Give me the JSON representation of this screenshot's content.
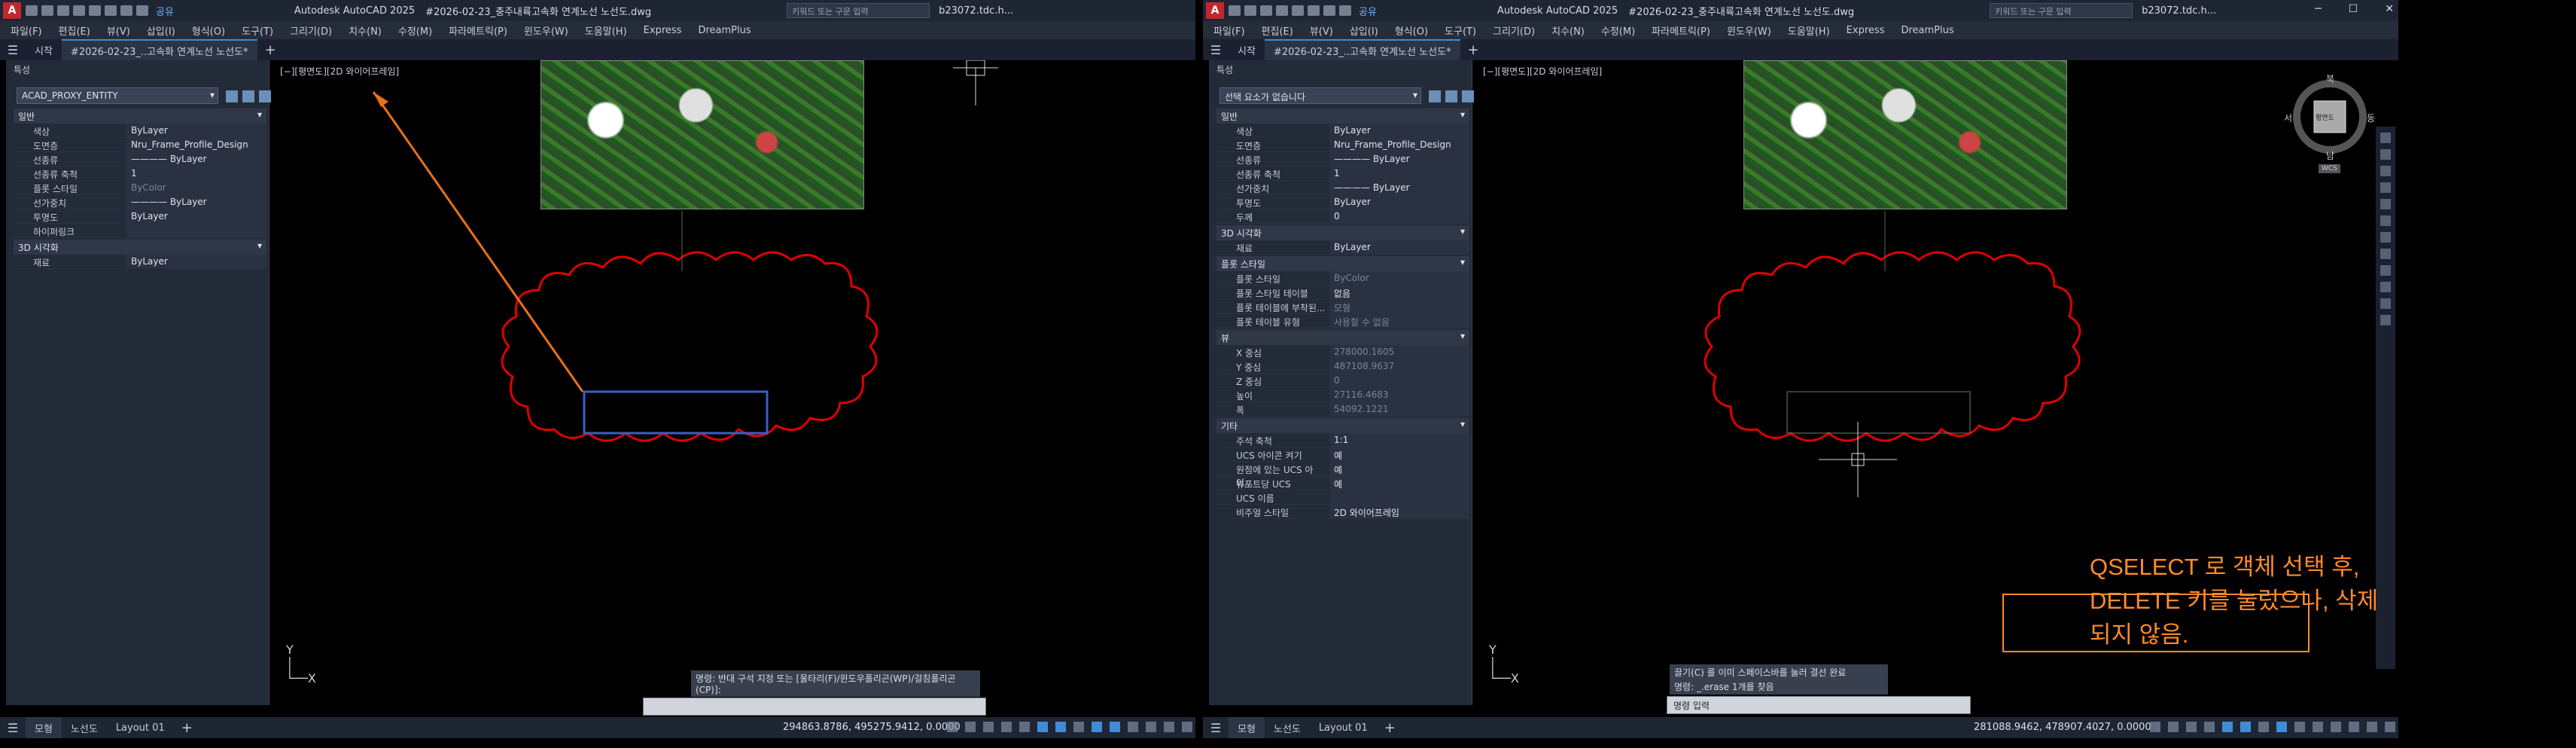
{
  "left": {
    "app_title": "Autodesk AutoCAD 2025",
    "doc_title": "#2026-02-23_충주내륙고속화 연계노선 노선도.dwg",
    "search_placeholder": "키워드 또는 구문 입력",
    "user": "b23072.tdc.h...",
    "share": "공유",
    "menus": [
      "파일(F)",
      "편집(E)",
      "뷰(V)",
      "삽입(I)",
      "형식(O)",
      "도구(T)",
      "그리기(D)",
      "치수(N)",
      "수정(M)",
      "파라메트릭(P)",
      "윈도우(W)",
      "도움말(H)",
      "Express",
      "DreamPlus"
    ],
    "tabs": [
      "시작",
      "#2026-02-23_..고속화 연계노선 노선도*"
    ],
    "palette_title": "특성",
    "selector": "ACAD_PROXY_ENTITY",
    "sections": [
      {
        "name": "일반",
        "rows": [
          [
            "색상",
            "ByLayer"
          ],
          [
            "도면층",
            "Nru_Frame_Profile_Design"
          ],
          [
            "선종류",
            "———— ByLayer"
          ],
          [
            "선종류 축척",
            "1"
          ],
          [
            "플롯 스타일",
            "ByColor"
          ],
          [
            "선가중치",
            "———— ByLayer"
          ],
          [
            "투명도",
            "ByLayer"
          ],
          [
            "하이퍼링크",
            ""
          ]
        ]
      },
      {
        "name": "3D 시각화",
        "rows": [
          [
            "재료",
            "ByLayer"
          ]
        ]
      }
    ],
    "viewport_label": "[−][평면도][2D 와이어프레임]",
    "command_prompt": "명령: 반대 구석 지정 또는 [울타리(F)/윈도우폴리곤(WP)/걸침폴리곤(CP)]:",
    "command_placeholder": "",
    "status_tabs": [
      "모형",
      "노선도",
      "Layout 01"
    ],
    "coords": "294863.8786, 495275.9412, 0.0000"
  },
  "right": {
    "app_title": "Autodesk AutoCAD 2025",
    "doc_title": "#2026-02-23_충주내륙고속화 연계노선 노선도.dwg",
    "search_placeholder": "키워드 또는 구문 입력",
    "user": "b23072.tdc.h...",
    "share": "공유",
    "menus": [
      "파일(F)",
      "편집(E)",
      "뷰(V)",
      "삽입(I)",
      "형식(O)",
      "도구(T)",
      "그리기(D)",
      "치수(N)",
      "수정(M)",
      "파라메트릭(P)",
      "윈도우(W)",
      "도움말(H)",
      "Express",
      "DreamPlus"
    ],
    "tabs": [
      "시작",
      "#2026-02-23_..고속화 연계노선 노선도*"
    ],
    "palette_title": "특성",
    "selector": "선택 요소가 없습니다",
    "sections": [
      {
        "name": "일반",
        "rows": [
          [
            "색상",
            "ByLayer"
          ],
          [
            "도면층",
            "Nru_Frame_Profile_Design"
          ],
          [
            "선종류",
            "———— ByLayer"
          ],
          [
            "선종류 축척",
            "1"
          ],
          [
            "선가중치",
            "———— ByLayer"
          ],
          [
            "투명도",
            "ByLayer"
          ],
          [
            "두께",
            "0"
          ]
        ]
      },
      {
        "name": "3D 시각화",
        "rows": [
          [
            "재료",
            "ByLayer"
          ]
        ]
      },
      {
        "name": "플롯 스타일",
        "rows": [
          [
            "플롯 스타일",
            "ByColor"
          ],
          [
            "플롯 스타일 테이블",
            "없음"
          ],
          [
            "플롯 테이블에 부착된...",
            "모형"
          ],
          [
            "플롯 테이블 유형",
            "사용할 수 없음"
          ]
        ]
      },
      {
        "name": "뷰",
        "rows": [
          [
            "X 중심",
            "278000.1605"
          ],
          [
            "Y 중심",
            "487108.9637"
          ],
          [
            "Z 중심",
            "0"
          ],
          [
            "높이",
            "27116.4683"
          ],
          [
            "폭",
            "54092.1221"
          ]
        ]
      },
      {
        "name": "기타",
        "rows": [
          [
            "주석 축척",
            "1:1"
          ],
          [
            "UCS 아이콘 켜기",
            "예"
          ],
          [
            "원점에 있는 UCS 아이...",
            "예"
          ],
          [
            "뷰포트당 UCS",
            "예"
          ],
          [
            "UCS 이름",
            ""
          ],
          [
            "비주얼 스타일",
            "2D 와이어프레임"
          ]
        ]
      }
    ],
    "viewport_label": "[−][평면도][2D 와이어프레임]",
    "viewcube_labels": {
      "n": "북",
      "s": "남",
      "e": "동",
      "w": "서",
      "face": "평면도",
      "wcs": "WCS"
    },
    "command_history": [
      "끌기(C) 를 이미 스페이스바를 눌러 결선 완료",
      "명령: _.erase 1개를 찾음"
    ],
    "command_placeholder": "명령 입력",
    "status_tabs": [
      "모형",
      "노선도",
      "Layout 01"
    ],
    "coords": "281088.9462, 478907.4027, 0.0000",
    "annotation": "QSELECT 로 객체 선택 후, DELETE 키를 눌렀으나, 삭제되지 않음."
  },
  "colors": {
    "annotation": "#ff8a2a",
    "cloud": "#e00000",
    "selection": "#3a5ec8",
    "arrow": "#e8701a"
  }
}
